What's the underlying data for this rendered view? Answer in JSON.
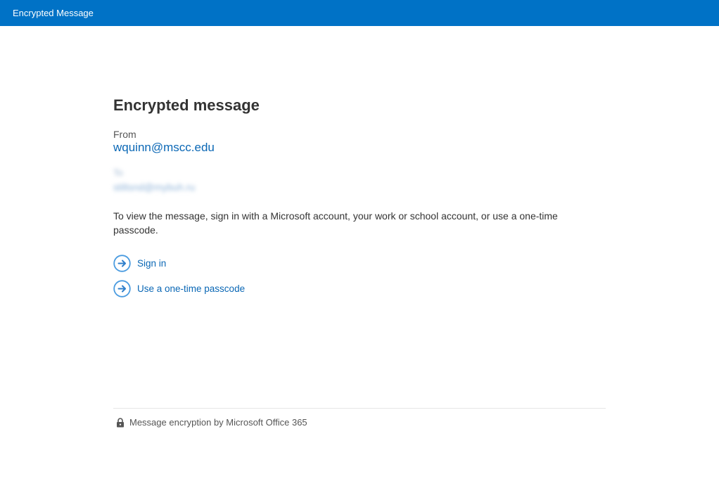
{
  "header": {
    "title": "Encrypted Message"
  },
  "main": {
    "heading": "Encrypted message",
    "from_label": "From",
    "from_value": "wquinn@mscc.edu",
    "to_label": "To",
    "to_value": "stiltsnd@mybuh.ru",
    "instruction": "To view the message, sign in with a Microsoft account, your work or school account, or use a one-time passcode.",
    "actions": [
      {
        "label": "Sign in",
        "icon": "arrow-circle-right-icon"
      },
      {
        "label": "Use a one-time passcode",
        "icon": "arrow-circle-right-icon"
      }
    ]
  },
  "footer": {
    "text": "Message encryption by Microsoft Office 365",
    "icon": "lock-icon"
  },
  "colors": {
    "brand": "#0072c6",
    "link": "#0a67b5",
    "icon_ring": "#4a9be0"
  }
}
